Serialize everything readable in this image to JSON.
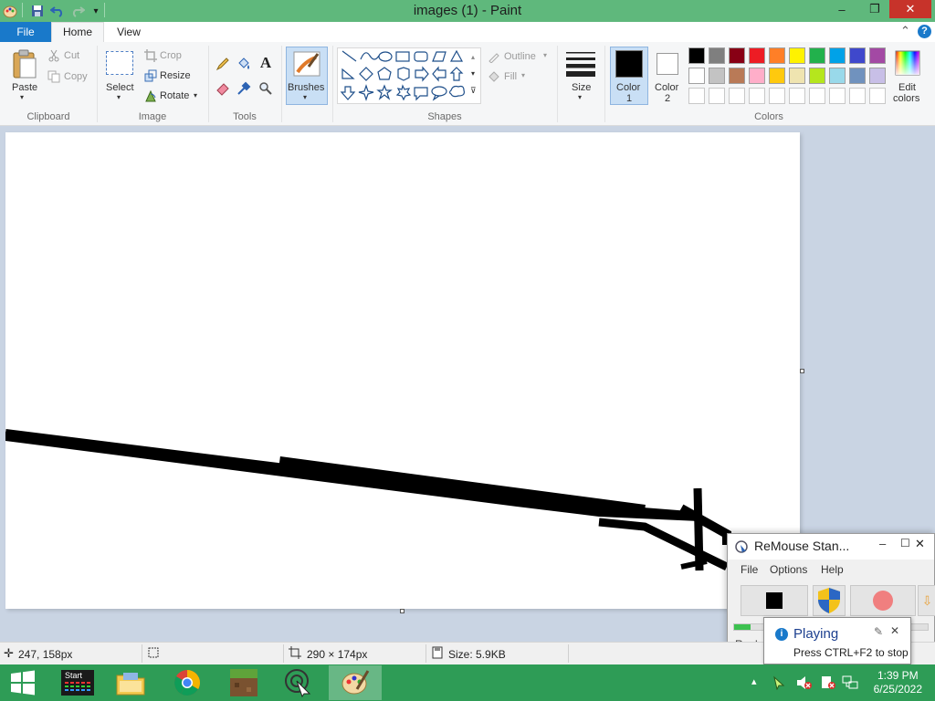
{
  "window": {
    "title": "images (1) - Paint",
    "controls": {
      "minimize": "–",
      "maximize": "❐",
      "close": "✕"
    }
  },
  "tabs": {
    "file": "File",
    "home": "Home",
    "view": "View",
    "collapse": "⌃",
    "help": "?"
  },
  "ribbon": {
    "clipboard": {
      "label": "Clipboard",
      "paste": "Paste",
      "cut": "Cut",
      "copy": "Copy"
    },
    "image": {
      "label": "Image",
      "select": "Select",
      "crop": "Crop",
      "resize": "Resize",
      "rotate": "Rotate"
    },
    "tools": {
      "label": "Tools",
      "text_glyph": "A"
    },
    "brushes": {
      "label": "Brushes"
    },
    "shapes": {
      "label": "Shapes",
      "outline": "Outline",
      "fill": "Fill"
    },
    "size": {
      "label": "Size"
    },
    "colors": {
      "label": "Colors",
      "color1": "Color\n1",
      "color1_line1": "Color",
      "color1_line2": "1",
      "color2_line1": "Color",
      "color2_line2": "2",
      "edit_line1": "Edit",
      "edit_line2": "colors",
      "color1_value": "#000000",
      "color2_value": "#ffffff",
      "palette_row1": [
        "#000000",
        "#7f7f7f",
        "#880015",
        "#ed1c24",
        "#ff7f27",
        "#fff200",
        "#22b14c",
        "#00a2e8",
        "#3f48cc",
        "#a349a4"
      ],
      "palette_row2": [
        "#ffffff",
        "#c3c3c3",
        "#b97a57",
        "#ffaec9",
        "#ffc90e",
        "#efe4b0",
        "#b5e61d",
        "#99d9ea",
        "#7092be",
        "#c8bfe7"
      ]
    }
  },
  "status": {
    "cursor_pos": "247, 158px",
    "selection_size": "",
    "image_size": "290 × 174px",
    "file_size": "Size: 5.9KB"
  },
  "remouse": {
    "title": "ReMouse Stan...",
    "menu": [
      "File",
      "Options",
      "Help"
    ],
    "replay": "Replay"
  },
  "balloon": {
    "title": "Playing",
    "message": "Press CTRL+F2 to stop"
  },
  "taskbar": {
    "start_label": "Start",
    "time": "1:39 PM",
    "date": "6/25/2022"
  }
}
